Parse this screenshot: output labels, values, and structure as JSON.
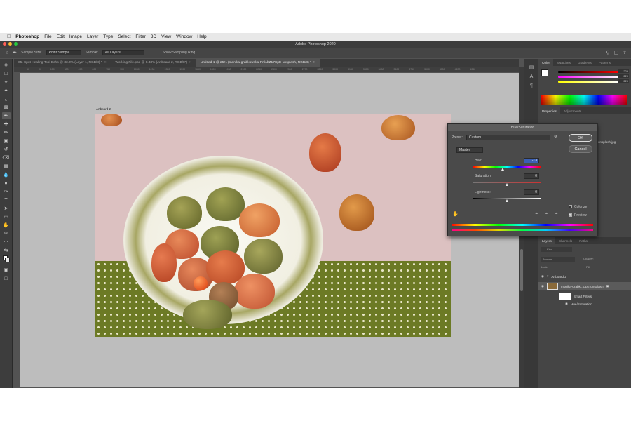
{
  "menubar": {
    "app": "Photoshop",
    "items": [
      "File",
      "Edit",
      "Image",
      "Layer",
      "Type",
      "Select",
      "Filter",
      "3D",
      "View",
      "Window",
      "Help"
    ]
  },
  "window": {
    "title": "Adobe Photoshop 2020"
  },
  "options": {
    "sample_size_label": "Sample Size:",
    "sample_size_value": "Point Sample",
    "sample_label": "Sample:",
    "sample_value": "All Layers",
    "show_ring": "Show Sampling Ring"
  },
  "tabs": [
    {
      "label": "05. Spot Healing Tool Echo @ 33.3% (Layer 1, RGB/8) *",
      "active": false
    },
    {
      "label": "Working File.psd @ 8.33% (Artboard 2, RGB/8*)",
      "active": false
    },
    {
      "label": "Untitled-1 @ 25% (monika-grabkowska-PnlAbZ17CpE-unsplash, RGB/8) *",
      "active": true
    }
  ],
  "ruler_ticks": [
    "50",
    "0",
    "150",
    "300",
    "450",
    "600",
    "750",
    "900",
    "1050",
    "1200",
    "1350",
    "1500",
    "1650",
    "1800",
    "1950",
    "2100",
    "2250",
    "2400",
    "2550",
    "2700",
    "2850",
    "3000",
    "3150",
    "3300",
    "3450",
    "3600",
    "3750",
    "3900",
    "4050",
    "4200",
    "4350"
  ],
  "artboard": {
    "label": "Artboard 2"
  },
  "color_panel": {
    "tabs": [
      "Color",
      "Swatches",
      "Gradients",
      "Patterns"
    ],
    "values": [
      "229",
      "229",
      "229"
    ]
  },
  "properties_panel": {
    "tabs": [
      "Properties",
      "Adjustments"
    ],
    "file_hint": "unsplash.jpg"
  },
  "layers_panel": {
    "tabs": [
      "Layers",
      "Channels",
      "Paths"
    ],
    "kind": "Kind",
    "blend": "Normal",
    "opacity": "Opacity:",
    "lock": "Lock:",
    "fill": "Fill:",
    "rows": [
      {
        "name": "Artboard 2"
      },
      {
        "name": "monika-grabk...CpE-unsplash"
      },
      {
        "name": "Smart Filters"
      },
      {
        "name": "Hue/Saturation"
      }
    ]
  },
  "dialog": {
    "title": "Hue/Saturation",
    "preset_label": "Preset:",
    "preset_value": "Custom",
    "channel": "Master",
    "hue_label": "Hue:",
    "hue_value": "-13",
    "hue_pos": 0.44,
    "sat_label": "Saturation:",
    "sat_value": "0",
    "sat_pos": 0.5,
    "light_label": "Lightness:",
    "light_value": "0",
    "light_pos": 0.5,
    "ok": "OK",
    "cancel": "Cancel",
    "colorize": "Colorize",
    "preview": "Preview",
    "preview_checked": true,
    "colorize_checked": false
  }
}
